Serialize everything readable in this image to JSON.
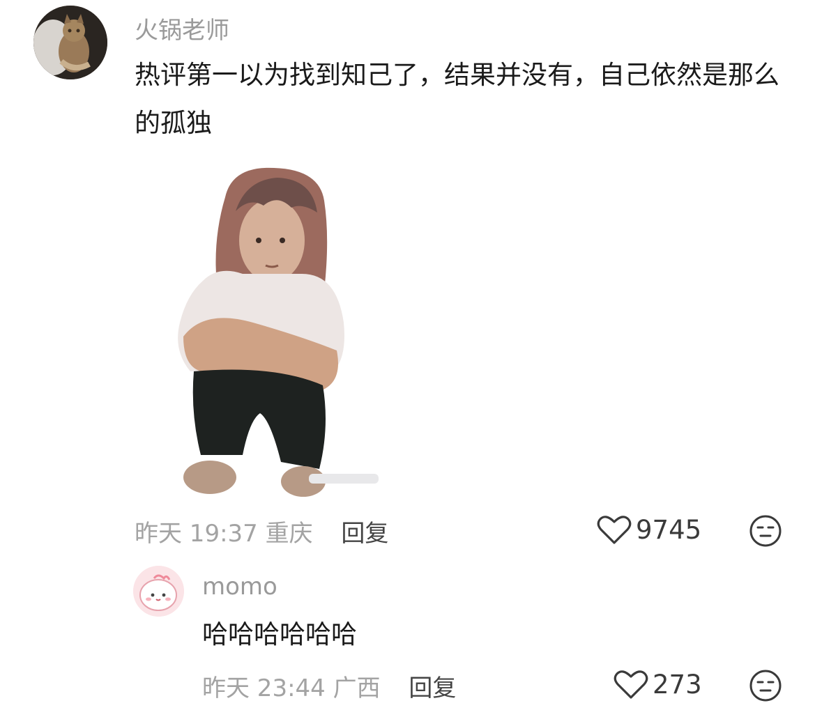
{
  "comment": {
    "username": "火锅老师",
    "text": "热评第一以为找到知己了，结果并没有，自己依然是那么的孤独",
    "time": "昨天 19:37",
    "location": "重庆",
    "reply_label": "回复",
    "likes": "9745",
    "avatar_icon": "cat-avatar",
    "sticker_icon": "crouching-person-sticker"
  },
  "reply": {
    "username": "momo",
    "text": "哈哈哈哈哈哈",
    "time": "昨天 23:44",
    "location": "广西",
    "reply_label": "回复",
    "likes": "273",
    "avatar_icon": "pink-cartoon-avatar"
  },
  "icons": {
    "like": "heart-outline-icon",
    "reaction": "emoji-face-icon"
  },
  "colors": {
    "username": "#9a9a9a",
    "meta": "#a3a3a3",
    "text": "#1a1a1a"
  }
}
